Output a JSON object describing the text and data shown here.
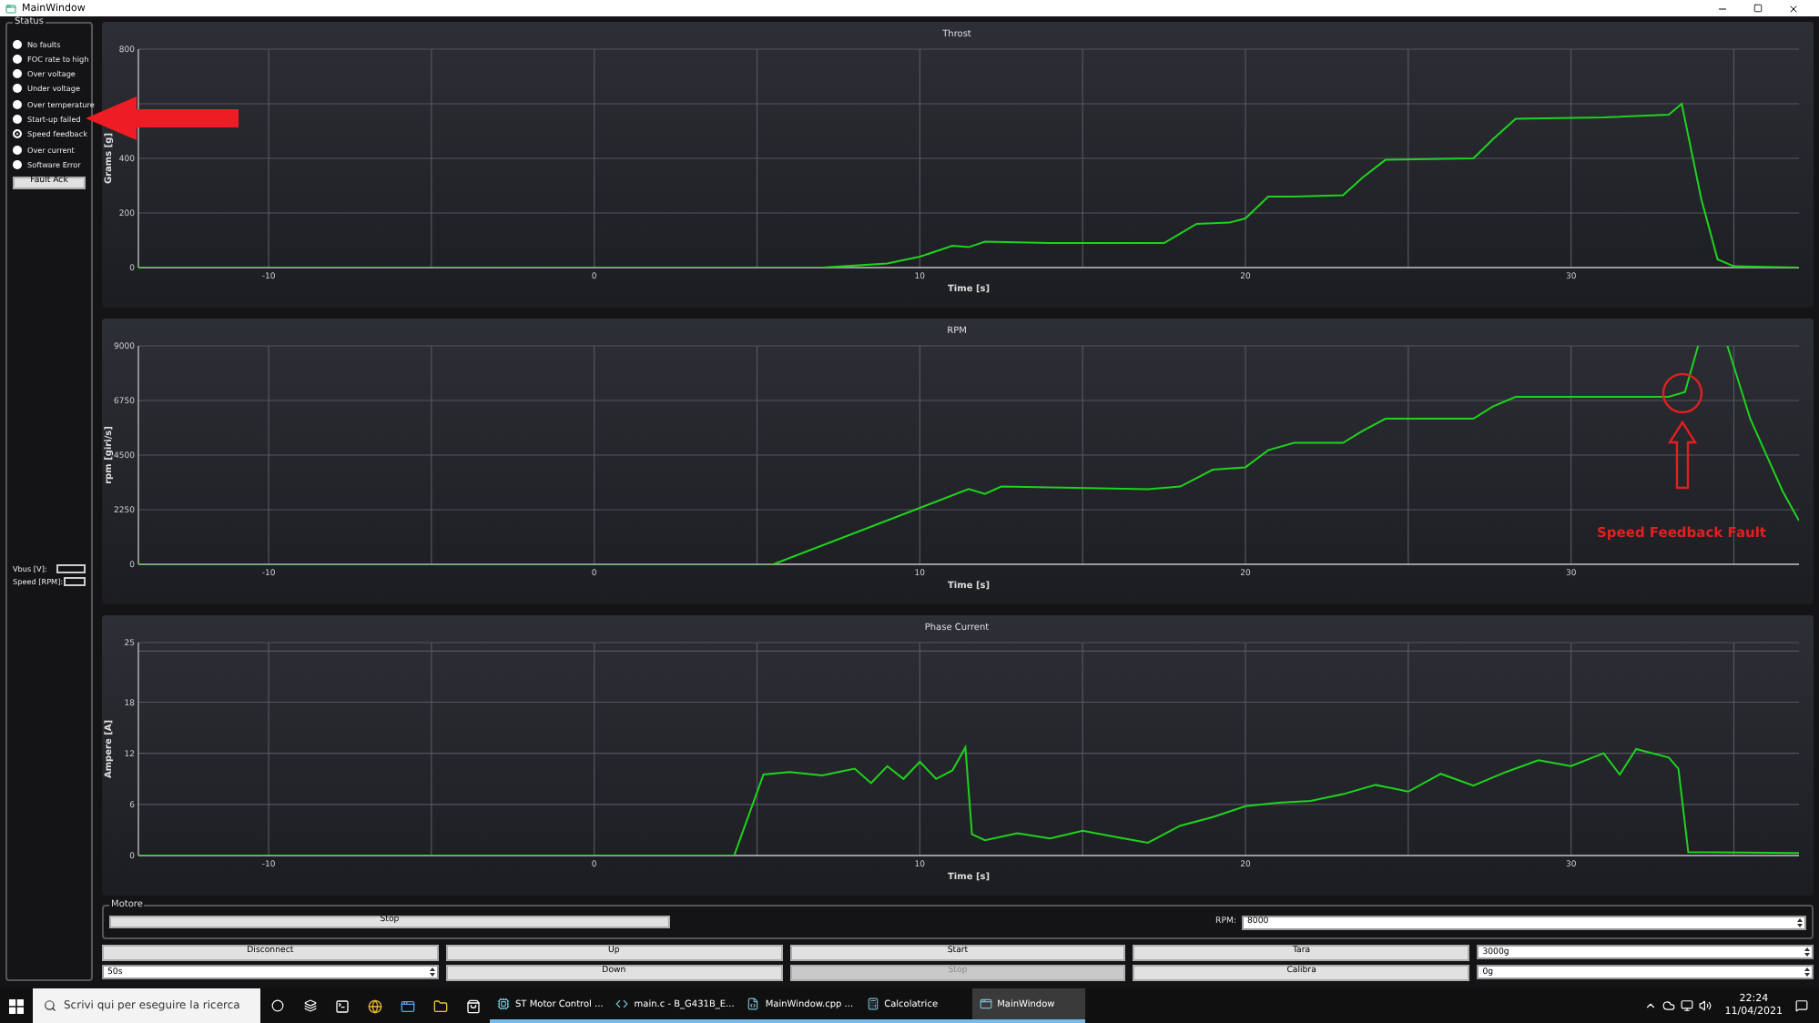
{
  "window": {
    "title": "MainWindow"
  },
  "status": {
    "title": "Status",
    "items": [
      {
        "label": "No faults",
        "selected": false
      },
      {
        "label": "FOC rate to high",
        "selected": false
      },
      {
        "label": "Over voltage",
        "selected": false
      },
      {
        "label": "Under voltage",
        "selected": false
      },
      {
        "label": "Over temperature",
        "selected": false
      },
      {
        "label": "Start-up failed",
        "selected": false
      },
      {
        "label": "Speed feedback",
        "selected": true
      },
      {
        "label": "Over current",
        "selected": false
      },
      {
        "label": "Software Error",
        "selected": false
      }
    ],
    "fault_ack": "Fault Ack"
  },
  "readouts": [
    {
      "label": "Vbus [V]:"
    },
    {
      "label": "Speed [RPM]:"
    }
  ],
  "charts": [
    {
      "chart_data": {
        "type": "line",
        "title": "Throst",
        "xlabel": "Time [s]",
        "ylabel": "Grams [g]",
        "grid": true,
        "xlim": [
          -14,
          37
        ],
        "ylim": [
          0,
          800
        ],
        "xticks": [
          -10,
          0,
          10,
          20,
          30
        ],
        "yticks": [
          0,
          200,
          400,
          800
        ],
        "x": [
          -14,
          7,
          9,
          10,
          11,
          11.5,
          12,
          14,
          17.5,
          18.5,
          19.5,
          20,
          20.7,
          21.5,
          23,
          23.6,
          24.3,
          27,
          27.6,
          28.3,
          31,
          33,
          33.4,
          34,
          34.5,
          35,
          37
        ],
        "series": [
          {
            "color": "#1ed31e",
            "values": [
              0,
              0,
              15,
              40,
              80,
              75,
              95,
              90,
              90,
              160,
              165,
              180,
              260,
              260,
              265,
              330,
              395,
              400,
              470,
              545,
              550,
              560,
              600,
              250,
              30,
              5,
              0
            ]
          }
        ]
      }
    },
    {
      "chart_data": {
        "type": "line",
        "title": "RPM",
        "xlabel": "Time [s]",
        "ylabel": "rpm [giri/s]",
        "grid": true,
        "xlim": [
          -14,
          37
        ],
        "ylim": [
          0,
          9000
        ],
        "xticks": [
          -10,
          0,
          10,
          20,
          30
        ],
        "yticks": [
          0,
          2250,
          4500,
          6750,
          9000
        ],
        "x": [
          -14,
          5.5,
          11.5,
          12,
          12.5,
          17,
          18,
          19,
          20,
          20.7,
          21.5,
          23,
          23.6,
          24.3,
          27,
          27.6,
          28.3,
          33,
          33.5,
          33.9,
          34.0,
          34.8,
          35.5,
          36.5,
          37
        ],
        "series": [
          {
            "color": "#1ed31e",
            "values": [
              0,
              0,
              3100,
              2900,
              3200,
              3100,
              3200,
              3900,
              4000,
              4700,
              5000,
              5000,
              5500,
              6000,
              6000,
              6500,
              6900,
              6900,
              7100,
              9000,
              null,
              9000,
              6000,
              3000,
              1800
            ]
          }
        ]
      }
    },
    {
      "chart_data": {
        "type": "line",
        "title": "Phase Current",
        "xlabel": "Time [s]",
        "ylabel": "Ampere [A]",
        "grid": true,
        "xlim": [
          -14,
          37
        ],
        "ylim": [
          0,
          25
        ],
        "xticks": [
          -10,
          0,
          10,
          20,
          30
        ],
        "yticks": [
          0,
          6,
          12,
          18,
          25
        ],
        "x": [
          -14,
          4.3,
          5.2,
          6,
          7,
          8,
          8.5,
          9,
          9.5,
          10,
          10.5,
          11,
          11.4,
          11.6,
          12,
          13,
          14,
          15,
          16,
          17,
          18,
          19,
          20,
          21,
          22,
          23,
          24,
          25,
          26,
          27,
          28,
          29,
          30,
          31,
          31.5,
          32,
          33,
          33.3,
          33.6,
          37
        ],
        "series": [
          {
            "color": "#1ed31e",
            "values": [
              0,
              0,
              9.5,
              9.8,
              9.4,
              10.2,
              8.5,
              10.5,
              9,
              11,
              9,
              10,
              12.7,
              2.5,
              1.8,
              2.6,
              2,
              2.9,
              2.2,
              1.5,
              3.5,
              4.5,
              5.8,
              6.2,
              6.4,
              7.2,
              8.3,
              7.5,
              9.6,
              8.2,
              9.8,
              11.2,
              10.5,
              12,
              9.5,
              12.5,
              11.5,
              10.2,
              0.4,
              0.3
            ]
          }
        ]
      }
    }
  ],
  "callout": {
    "text": "Speed Feedback Fault"
  },
  "motore": {
    "title": "Motore",
    "stop": "Stop",
    "rpm_label": "RPM:",
    "rpm_value": "8000"
  },
  "controls": [
    [
      {
        "kind": "button",
        "label": "Disconnect",
        "disabled": false
      },
      {
        "kind": "button",
        "label": "Up",
        "disabled": false
      },
      {
        "kind": "button",
        "label": "Start",
        "disabled": false
      },
      {
        "kind": "button",
        "label": "Tara",
        "disabled": false
      },
      {
        "kind": "spin",
        "value": "3000g"
      }
    ],
    [
      {
        "kind": "spin",
        "value": "50s"
      },
      {
        "kind": "button",
        "label": "Down",
        "disabled": false
      },
      {
        "kind": "button",
        "label": "Stop",
        "disabled": true
      },
      {
        "kind": "button",
        "label": "Calibra",
        "disabled": false
      },
      {
        "kind": "spin",
        "value": "0g"
      }
    ]
  ],
  "taskbar": {
    "search_placeholder": "Scrivi qui per eseguire la ricerca",
    "apps": [
      {
        "label": "ST Motor Control ...",
        "selected": false
      },
      {
        "label": "main.c - B_G431B_E...",
        "selected": false
      },
      {
        "label": "MainWindow.cpp ...",
        "selected": false
      },
      {
        "label": "Calcolatrice",
        "selected": false
      },
      {
        "label": "MainWindow",
        "selected": true
      }
    ],
    "time": "22:24",
    "date": "11/04/2021"
  }
}
